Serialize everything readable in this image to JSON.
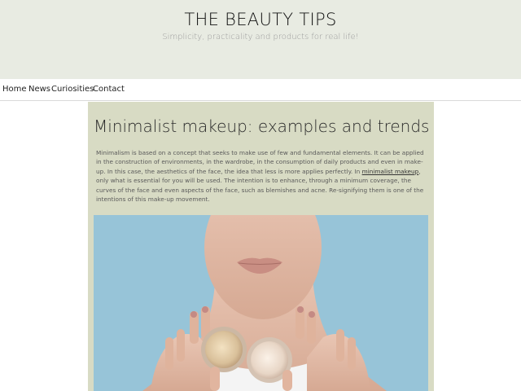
{
  "site": {
    "title": "THE BEAUTY TIPS",
    "tagline": "Simplicity, practicality and products for real life!"
  },
  "nav": {
    "items": [
      {
        "label": "Home"
      },
      {
        "label": "News"
      },
      {
        "label": "Curiosities"
      },
      {
        "label": "Contact"
      }
    ]
  },
  "article": {
    "title": "Minimalist makeup: examples and trends",
    "body_before_link": "Minimalism is based on a concept that seeks to make use of few and fundamental elements. It can be applied in the construction of environments, in the wardrobe, in the consumption of daily products and even in make-up. In this case, the aesthetics of the face, the idea that less is more applies perfectly. In ",
    "link_text": "minimalist makeup",
    "body_after_link": ", only what is essential for you will be used. The intention is to enhance, through a minimum coverage, the curves of the face and even aspects of the face, such as blemishes and acne. Re-signifying them is one of the intentions of this make-up movement.",
    "image_description": "woman holding two jars of cream"
  },
  "colors": {
    "header_bg": "#e8ebe2",
    "article_bg": "#d8dbc4",
    "image_bg": "#97c4d8"
  }
}
